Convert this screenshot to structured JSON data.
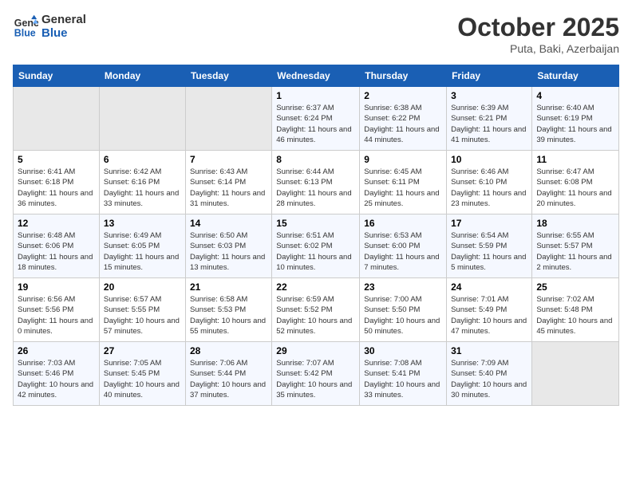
{
  "header": {
    "logo_line1": "General",
    "logo_line2": "Blue",
    "month": "October 2025",
    "location": "Puta, Baki, Azerbaijan"
  },
  "days_of_week": [
    "Sunday",
    "Monday",
    "Tuesday",
    "Wednesday",
    "Thursday",
    "Friday",
    "Saturday"
  ],
  "weeks": [
    [
      {
        "day": "",
        "sunrise": "",
        "sunset": "",
        "daylight": ""
      },
      {
        "day": "",
        "sunrise": "",
        "sunset": "",
        "daylight": ""
      },
      {
        "day": "",
        "sunrise": "",
        "sunset": "",
        "daylight": ""
      },
      {
        "day": "1",
        "sunrise": "Sunrise: 6:37 AM",
        "sunset": "Sunset: 6:24 PM",
        "daylight": "Daylight: 11 hours and 46 minutes."
      },
      {
        "day": "2",
        "sunrise": "Sunrise: 6:38 AM",
        "sunset": "Sunset: 6:22 PM",
        "daylight": "Daylight: 11 hours and 44 minutes."
      },
      {
        "day": "3",
        "sunrise": "Sunrise: 6:39 AM",
        "sunset": "Sunset: 6:21 PM",
        "daylight": "Daylight: 11 hours and 41 minutes."
      },
      {
        "day": "4",
        "sunrise": "Sunrise: 6:40 AM",
        "sunset": "Sunset: 6:19 PM",
        "daylight": "Daylight: 11 hours and 39 minutes."
      }
    ],
    [
      {
        "day": "5",
        "sunrise": "Sunrise: 6:41 AM",
        "sunset": "Sunset: 6:18 PM",
        "daylight": "Daylight: 11 hours and 36 minutes."
      },
      {
        "day": "6",
        "sunrise": "Sunrise: 6:42 AM",
        "sunset": "Sunset: 6:16 PM",
        "daylight": "Daylight: 11 hours and 33 minutes."
      },
      {
        "day": "7",
        "sunrise": "Sunrise: 6:43 AM",
        "sunset": "Sunset: 6:14 PM",
        "daylight": "Daylight: 11 hours and 31 minutes."
      },
      {
        "day": "8",
        "sunrise": "Sunrise: 6:44 AM",
        "sunset": "Sunset: 6:13 PM",
        "daylight": "Daylight: 11 hours and 28 minutes."
      },
      {
        "day": "9",
        "sunrise": "Sunrise: 6:45 AM",
        "sunset": "Sunset: 6:11 PM",
        "daylight": "Daylight: 11 hours and 25 minutes."
      },
      {
        "day": "10",
        "sunrise": "Sunrise: 6:46 AM",
        "sunset": "Sunset: 6:10 PM",
        "daylight": "Daylight: 11 hours and 23 minutes."
      },
      {
        "day": "11",
        "sunrise": "Sunrise: 6:47 AM",
        "sunset": "Sunset: 6:08 PM",
        "daylight": "Daylight: 11 hours and 20 minutes."
      }
    ],
    [
      {
        "day": "12",
        "sunrise": "Sunrise: 6:48 AM",
        "sunset": "Sunset: 6:06 PM",
        "daylight": "Daylight: 11 hours and 18 minutes."
      },
      {
        "day": "13",
        "sunrise": "Sunrise: 6:49 AM",
        "sunset": "Sunset: 6:05 PM",
        "daylight": "Daylight: 11 hours and 15 minutes."
      },
      {
        "day": "14",
        "sunrise": "Sunrise: 6:50 AM",
        "sunset": "Sunset: 6:03 PM",
        "daylight": "Daylight: 11 hours and 13 minutes."
      },
      {
        "day": "15",
        "sunrise": "Sunrise: 6:51 AM",
        "sunset": "Sunset: 6:02 PM",
        "daylight": "Daylight: 11 hours and 10 minutes."
      },
      {
        "day": "16",
        "sunrise": "Sunrise: 6:53 AM",
        "sunset": "Sunset: 6:00 PM",
        "daylight": "Daylight: 11 hours and 7 minutes."
      },
      {
        "day": "17",
        "sunrise": "Sunrise: 6:54 AM",
        "sunset": "Sunset: 5:59 PM",
        "daylight": "Daylight: 11 hours and 5 minutes."
      },
      {
        "day": "18",
        "sunrise": "Sunrise: 6:55 AM",
        "sunset": "Sunset: 5:57 PM",
        "daylight": "Daylight: 11 hours and 2 minutes."
      }
    ],
    [
      {
        "day": "19",
        "sunrise": "Sunrise: 6:56 AM",
        "sunset": "Sunset: 5:56 PM",
        "daylight": "Daylight: 11 hours and 0 minutes."
      },
      {
        "day": "20",
        "sunrise": "Sunrise: 6:57 AM",
        "sunset": "Sunset: 5:55 PM",
        "daylight": "Daylight: 10 hours and 57 minutes."
      },
      {
        "day": "21",
        "sunrise": "Sunrise: 6:58 AM",
        "sunset": "Sunset: 5:53 PM",
        "daylight": "Daylight: 10 hours and 55 minutes."
      },
      {
        "day": "22",
        "sunrise": "Sunrise: 6:59 AM",
        "sunset": "Sunset: 5:52 PM",
        "daylight": "Daylight: 10 hours and 52 minutes."
      },
      {
        "day": "23",
        "sunrise": "Sunrise: 7:00 AM",
        "sunset": "Sunset: 5:50 PM",
        "daylight": "Daylight: 10 hours and 50 minutes."
      },
      {
        "day": "24",
        "sunrise": "Sunrise: 7:01 AM",
        "sunset": "Sunset: 5:49 PM",
        "daylight": "Daylight: 10 hours and 47 minutes."
      },
      {
        "day": "25",
        "sunrise": "Sunrise: 7:02 AM",
        "sunset": "Sunset: 5:48 PM",
        "daylight": "Daylight: 10 hours and 45 minutes."
      }
    ],
    [
      {
        "day": "26",
        "sunrise": "Sunrise: 7:03 AM",
        "sunset": "Sunset: 5:46 PM",
        "daylight": "Daylight: 10 hours and 42 minutes."
      },
      {
        "day": "27",
        "sunrise": "Sunrise: 7:05 AM",
        "sunset": "Sunset: 5:45 PM",
        "daylight": "Daylight: 10 hours and 40 minutes."
      },
      {
        "day": "28",
        "sunrise": "Sunrise: 7:06 AM",
        "sunset": "Sunset: 5:44 PM",
        "daylight": "Daylight: 10 hours and 37 minutes."
      },
      {
        "day": "29",
        "sunrise": "Sunrise: 7:07 AM",
        "sunset": "Sunset: 5:42 PM",
        "daylight": "Daylight: 10 hours and 35 minutes."
      },
      {
        "day": "30",
        "sunrise": "Sunrise: 7:08 AM",
        "sunset": "Sunset: 5:41 PM",
        "daylight": "Daylight: 10 hours and 33 minutes."
      },
      {
        "day": "31",
        "sunrise": "Sunrise: 7:09 AM",
        "sunset": "Sunset: 5:40 PM",
        "daylight": "Daylight: 10 hours and 30 minutes."
      },
      {
        "day": "",
        "sunrise": "",
        "sunset": "",
        "daylight": ""
      }
    ]
  ]
}
